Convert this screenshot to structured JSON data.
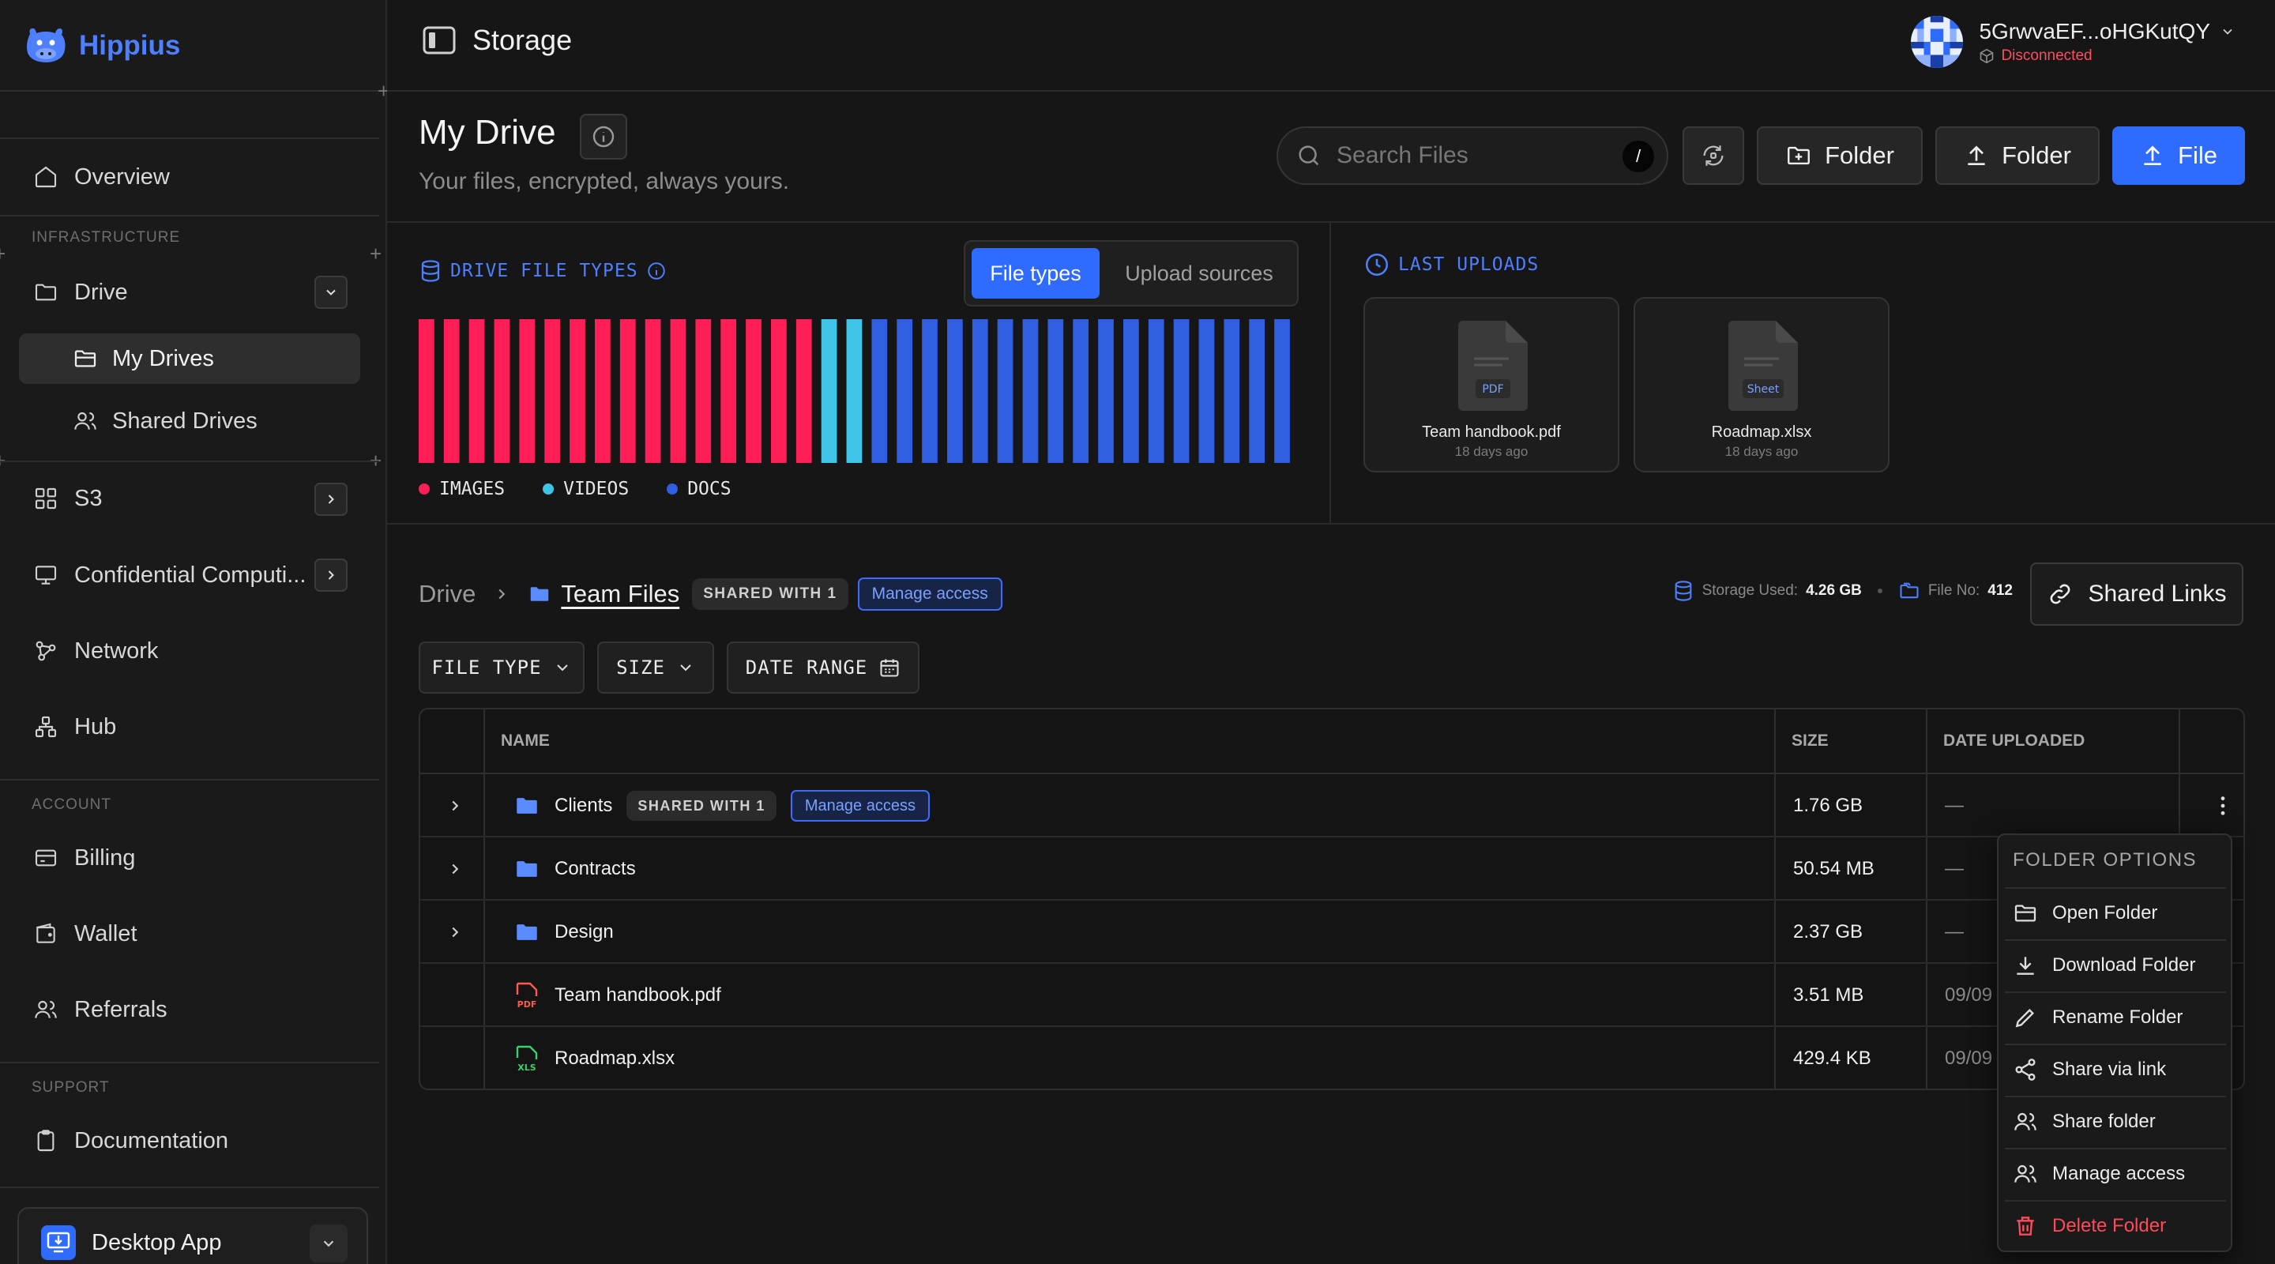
{
  "app": {
    "name": "Hippius",
    "header_title": "Storage"
  },
  "account": {
    "name": "5GrwvaEF...oHGKutQY",
    "status": "Disconnected"
  },
  "sidebar": {
    "overview": "Overview",
    "section_infra": "INFRASTRUCTURE",
    "drive": "Drive",
    "my_drives": "My Drives",
    "shared_drives": "Shared Drives",
    "s3": "S3",
    "confidential": "Confidential Computi...",
    "network": "Network",
    "hub": "Hub",
    "section_account": "ACCOUNT",
    "billing": "Billing",
    "wallet": "Wallet",
    "referrals": "Referrals",
    "section_support": "SUPPORT",
    "documentation": "Documentation",
    "desktop_app": "Desktop App"
  },
  "page": {
    "title": "My Drive",
    "subtitle": "Your files, encrypted, always yours.",
    "search_placeholder": "Search Files",
    "search_shortcut": "/",
    "btn_new_folder": "Folder",
    "btn_upload_folder": "Folder",
    "btn_upload_file": "File"
  },
  "file_types": {
    "label": "DRIVE FILE TYPES",
    "tab_active": "File types",
    "tab_other": "Upload sources",
    "legend": [
      {
        "name": "IMAGES",
        "color": "#ff1f56"
      },
      {
        "name": "VIDEOS",
        "color": "#3fc3e6"
      },
      {
        "name": "DOCS",
        "color": "#2f5fe0"
      }
    ]
  },
  "chart_data": {
    "type": "bar",
    "values": [
      "images",
      "images",
      "images",
      "images",
      "images",
      "images",
      "images",
      "images",
      "images",
      "images",
      "images",
      "images",
      "images",
      "images",
      "images",
      "images",
      "videos",
      "videos",
      "docs",
      "docs",
      "docs",
      "docs",
      "docs",
      "docs",
      "docs",
      "docs",
      "docs",
      "docs",
      "docs",
      "docs",
      "docs",
      "docs",
      "docs",
      "docs",
      "docs"
    ],
    "series": [
      {
        "name": "IMAGES",
        "count": 16,
        "color": "#ff1f56"
      },
      {
        "name": "VIDEOS",
        "count": 2,
        "color": "#3fc3e6"
      },
      {
        "name": "DOCS",
        "count": 17,
        "color": "#2f5fe0"
      }
    ]
  },
  "last_uploads": {
    "label": "LAST UPLOADS",
    "items": [
      {
        "name": "Team handbook.pdf",
        "date": "18 days ago",
        "tag": "PDF"
      },
      {
        "name": "Roadmap.xlsx",
        "date": "18 days ago",
        "tag": "Sheet"
      }
    ]
  },
  "breadcrumb": {
    "root": "Drive",
    "current": "Team Files",
    "shared_badge": "SHARED WITH 1",
    "manage": "Manage access"
  },
  "stats": {
    "storage_label": "Storage Used:",
    "storage_value": "4.26 GB",
    "files_label": "File No:",
    "files_value": "412"
  },
  "shared_links": "Shared Links",
  "filters": {
    "file_type": "FILE TYPE",
    "size": "SIZE",
    "date_range": "DATE RANGE"
  },
  "table": {
    "col_name": "NAME",
    "col_size": "SIZE",
    "col_date": "DATE UPLOADED",
    "rows": [
      {
        "name": "Clients",
        "size": "1.76 GB",
        "date": "—",
        "kind": "folder",
        "shared": "SHARED WITH 1",
        "manage": "Manage access"
      },
      {
        "name": "Contracts",
        "size": "50.54 MB",
        "date": "—",
        "kind": "folder"
      },
      {
        "name": "Design",
        "size": "2.37 GB",
        "date": "—",
        "kind": "folder"
      },
      {
        "name": "Team handbook.pdf",
        "size": "3.51 MB",
        "date": "09/09",
        "kind": "pdf",
        "file_tag": "PDF"
      },
      {
        "name": "Roadmap.xlsx",
        "size": "429.4 KB",
        "date": "09/09",
        "kind": "xls",
        "file_tag": "XLS"
      }
    ]
  },
  "menu": {
    "title": "FOLDER OPTIONS",
    "items": [
      "Open Folder",
      "Download Folder",
      "Rename Folder",
      "Share via link",
      "Share folder",
      "Manage access",
      "Delete Folder"
    ]
  }
}
